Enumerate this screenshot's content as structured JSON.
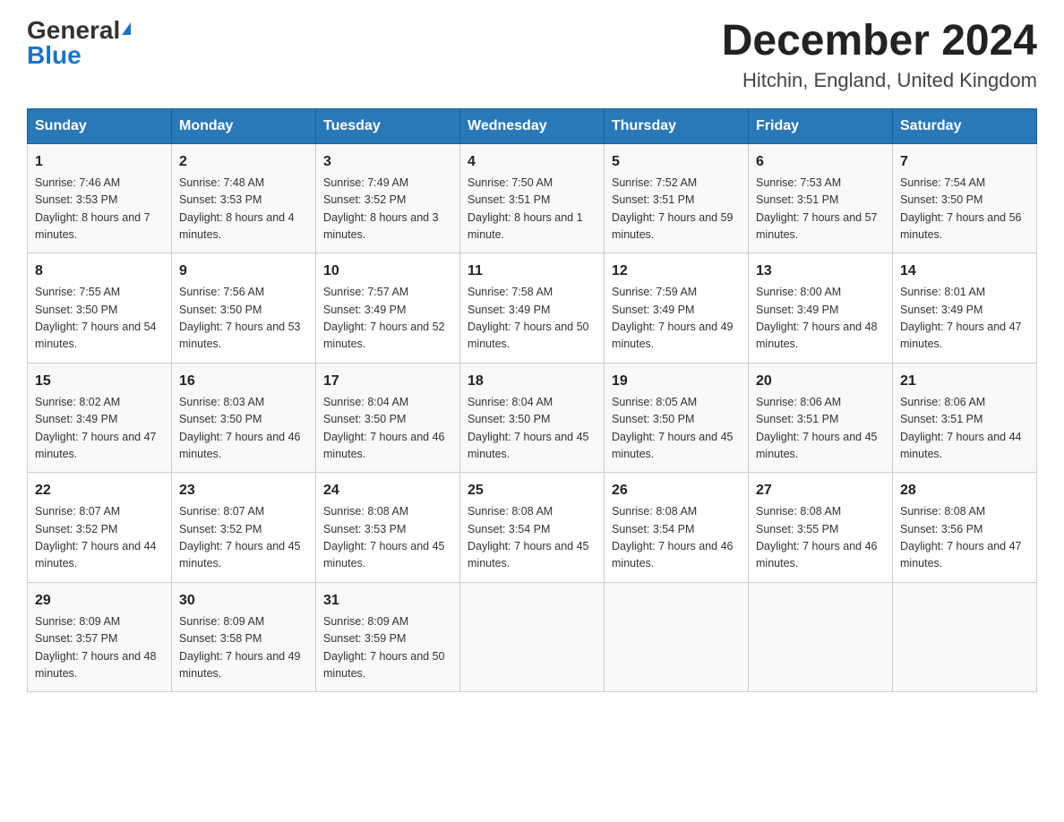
{
  "header": {
    "logo_general": "General",
    "logo_blue": "Blue",
    "title": "December 2024",
    "subtitle": "Hitchin, England, United Kingdom"
  },
  "weekdays": [
    "Sunday",
    "Monday",
    "Tuesday",
    "Wednesday",
    "Thursday",
    "Friday",
    "Saturday"
  ],
  "weeks": [
    [
      {
        "day": "1",
        "sunrise": "7:46 AM",
        "sunset": "3:53 PM",
        "daylight": "8 hours and 7 minutes."
      },
      {
        "day": "2",
        "sunrise": "7:48 AM",
        "sunset": "3:53 PM",
        "daylight": "8 hours and 4 minutes."
      },
      {
        "day": "3",
        "sunrise": "7:49 AM",
        "sunset": "3:52 PM",
        "daylight": "8 hours and 3 minutes."
      },
      {
        "day": "4",
        "sunrise": "7:50 AM",
        "sunset": "3:51 PM",
        "daylight": "8 hours and 1 minute."
      },
      {
        "day": "5",
        "sunrise": "7:52 AM",
        "sunset": "3:51 PM",
        "daylight": "7 hours and 59 minutes."
      },
      {
        "day": "6",
        "sunrise": "7:53 AM",
        "sunset": "3:51 PM",
        "daylight": "7 hours and 57 minutes."
      },
      {
        "day": "7",
        "sunrise": "7:54 AM",
        "sunset": "3:50 PM",
        "daylight": "7 hours and 56 minutes."
      }
    ],
    [
      {
        "day": "8",
        "sunrise": "7:55 AM",
        "sunset": "3:50 PM",
        "daylight": "7 hours and 54 minutes."
      },
      {
        "day": "9",
        "sunrise": "7:56 AM",
        "sunset": "3:50 PM",
        "daylight": "7 hours and 53 minutes."
      },
      {
        "day": "10",
        "sunrise": "7:57 AM",
        "sunset": "3:49 PM",
        "daylight": "7 hours and 52 minutes."
      },
      {
        "day": "11",
        "sunrise": "7:58 AM",
        "sunset": "3:49 PM",
        "daylight": "7 hours and 50 minutes."
      },
      {
        "day": "12",
        "sunrise": "7:59 AM",
        "sunset": "3:49 PM",
        "daylight": "7 hours and 49 minutes."
      },
      {
        "day": "13",
        "sunrise": "8:00 AM",
        "sunset": "3:49 PM",
        "daylight": "7 hours and 48 minutes."
      },
      {
        "day": "14",
        "sunrise": "8:01 AM",
        "sunset": "3:49 PM",
        "daylight": "7 hours and 47 minutes."
      }
    ],
    [
      {
        "day": "15",
        "sunrise": "8:02 AM",
        "sunset": "3:49 PM",
        "daylight": "7 hours and 47 minutes."
      },
      {
        "day": "16",
        "sunrise": "8:03 AM",
        "sunset": "3:50 PM",
        "daylight": "7 hours and 46 minutes."
      },
      {
        "day": "17",
        "sunrise": "8:04 AM",
        "sunset": "3:50 PM",
        "daylight": "7 hours and 46 minutes."
      },
      {
        "day": "18",
        "sunrise": "8:04 AM",
        "sunset": "3:50 PM",
        "daylight": "7 hours and 45 minutes."
      },
      {
        "day": "19",
        "sunrise": "8:05 AM",
        "sunset": "3:50 PM",
        "daylight": "7 hours and 45 minutes."
      },
      {
        "day": "20",
        "sunrise": "8:06 AM",
        "sunset": "3:51 PM",
        "daylight": "7 hours and 45 minutes."
      },
      {
        "day": "21",
        "sunrise": "8:06 AM",
        "sunset": "3:51 PM",
        "daylight": "7 hours and 44 minutes."
      }
    ],
    [
      {
        "day": "22",
        "sunrise": "8:07 AM",
        "sunset": "3:52 PM",
        "daylight": "7 hours and 44 minutes."
      },
      {
        "day": "23",
        "sunrise": "8:07 AM",
        "sunset": "3:52 PM",
        "daylight": "7 hours and 45 minutes."
      },
      {
        "day": "24",
        "sunrise": "8:08 AM",
        "sunset": "3:53 PM",
        "daylight": "7 hours and 45 minutes."
      },
      {
        "day": "25",
        "sunrise": "8:08 AM",
        "sunset": "3:54 PM",
        "daylight": "7 hours and 45 minutes."
      },
      {
        "day": "26",
        "sunrise": "8:08 AM",
        "sunset": "3:54 PM",
        "daylight": "7 hours and 46 minutes."
      },
      {
        "day": "27",
        "sunrise": "8:08 AM",
        "sunset": "3:55 PM",
        "daylight": "7 hours and 46 minutes."
      },
      {
        "day": "28",
        "sunrise": "8:08 AM",
        "sunset": "3:56 PM",
        "daylight": "7 hours and 47 minutes."
      }
    ],
    [
      {
        "day": "29",
        "sunrise": "8:09 AM",
        "sunset": "3:57 PM",
        "daylight": "7 hours and 48 minutes."
      },
      {
        "day": "30",
        "sunrise": "8:09 AM",
        "sunset": "3:58 PM",
        "daylight": "7 hours and 49 minutes."
      },
      {
        "day": "31",
        "sunrise": "8:09 AM",
        "sunset": "3:59 PM",
        "daylight": "7 hours and 50 minutes."
      },
      null,
      null,
      null,
      null
    ]
  ]
}
